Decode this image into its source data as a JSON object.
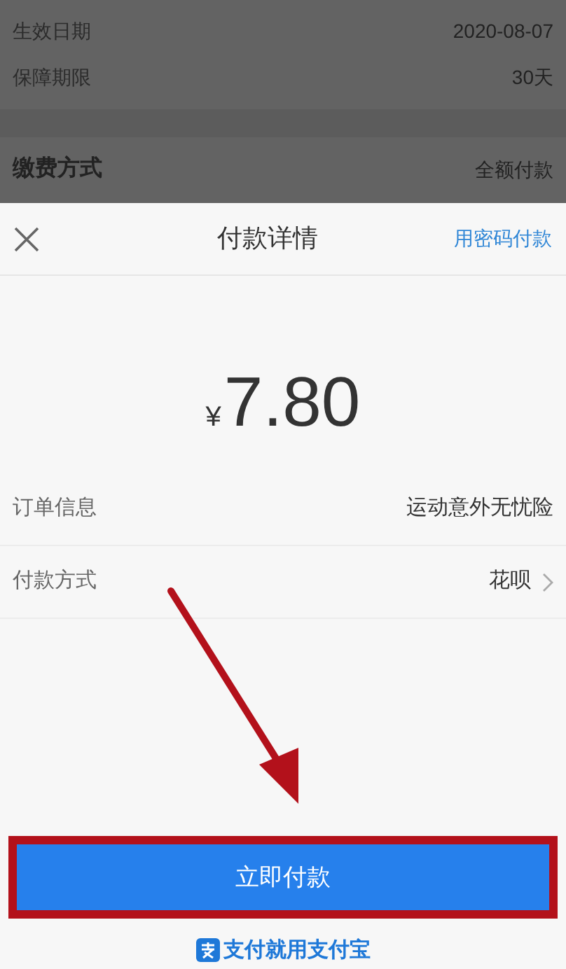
{
  "background_form": {
    "rows": [
      {
        "label": "生效日期",
        "value": "2020-08-07"
      },
      {
        "label": "保障期限",
        "value": "30天"
      }
    ],
    "payment_section": {
      "label": "缴费方式",
      "value": "全额付款"
    }
  },
  "payment_sheet": {
    "title": "付款详情",
    "link": "用密码付款",
    "currency": "¥",
    "amount": "7.80",
    "rows": [
      {
        "label": "订单信息",
        "value": "运动意外无忧险",
        "chevron": false
      },
      {
        "label": "付款方式",
        "value": "花呗",
        "chevron": true
      }
    ],
    "pay_button": "立即付款",
    "footer": "支付就用支付宝"
  }
}
